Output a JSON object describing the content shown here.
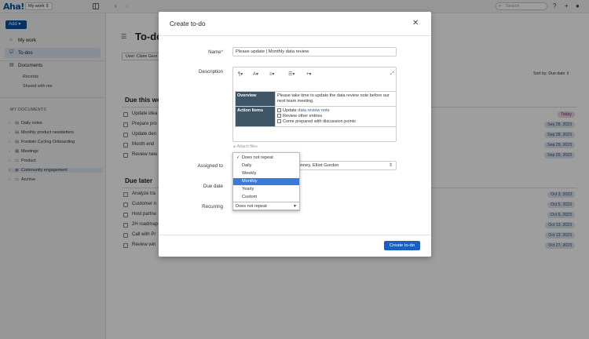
{
  "topbar": {
    "logo": "Aha!",
    "workspace": "My work",
    "search_placeholder": "Search"
  },
  "sidebar": {
    "add_label": "Add",
    "nav": [
      {
        "label": "My work"
      },
      {
        "label": "To-dos"
      },
      {
        "label": "Documents"
      }
    ],
    "sub": [
      "Recents",
      "Shared with me"
    ],
    "my_docs_heading": "MY DOCUMENTS",
    "docs": [
      "Daily notes",
      "Monthly product newsletters",
      "Fredwin Cycling Onboarding",
      "Meetings",
      "Product",
      "Community engagement",
      "Archive"
    ]
  },
  "main": {
    "title": "To-dos",
    "user_filter": "User: Claire Geor",
    "sort": "Sort by: Due date",
    "section1": {
      "title": "Due this week",
      "rows": [
        {
          "text": "Update idea",
          "date": "Today"
        },
        {
          "text": "Prepare pro",
          "date": "Sep 28, 2023"
        },
        {
          "text": "Update den",
          "date": "Sep 28, 2023"
        },
        {
          "text": "Month end",
          "date": "Sep 29, 2023"
        },
        {
          "text": "Review new",
          "date": "Sep 29, 2023"
        }
      ]
    },
    "section2": {
      "title": "Due later",
      "rows": [
        {
          "text": "Analyze tra",
          "date": "Oct 3, 2023"
        },
        {
          "text": "Customer n",
          "date": "Oct 5, 2023"
        },
        {
          "text": "Host partne",
          "date": "Oct 6, 2023"
        },
        {
          "text": "2H roadmap",
          "date": "Oct 13, 2023"
        },
        {
          "text": "Call with Pr",
          "date": "Oct 13, 2023"
        },
        {
          "text": "Review win",
          "date": "Oct 27, 2023"
        }
      ]
    }
  },
  "modal": {
    "title": "Create to-do",
    "name_label": "Name",
    "required_mark": "*",
    "name_value": "Please update | Monthly data review",
    "description_label": "Description",
    "overview_head": "Overview",
    "overview_text": "Please take time to update the data review note before our next team meeting.",
    "action_head": "Action Items",
    "action1_prefix": "Update ",
    "action1_link": "data review note",
    "action2": "Review other entries",
    "action3": "Come prepared with discussion points",
    "attach": "Attach files",
    "assigned_label": "Assigned to",
    "assigned_value": "y Kinney, Elliot Gordon",
    "due_label": "Due date",
    "recurring_label": "Recurring",
    "recurring_value": "Does not repeat",
    "options": [
      "Does not repeat",
      "Daily",
      "Weekly",
      "Monthly",
      "Yearly",
      "Custom"
    ],
    "highlighted_option": "Monthly",
    "checked_option": "Does not repeat",
    "create_button": "Create to-do"
  }
}
